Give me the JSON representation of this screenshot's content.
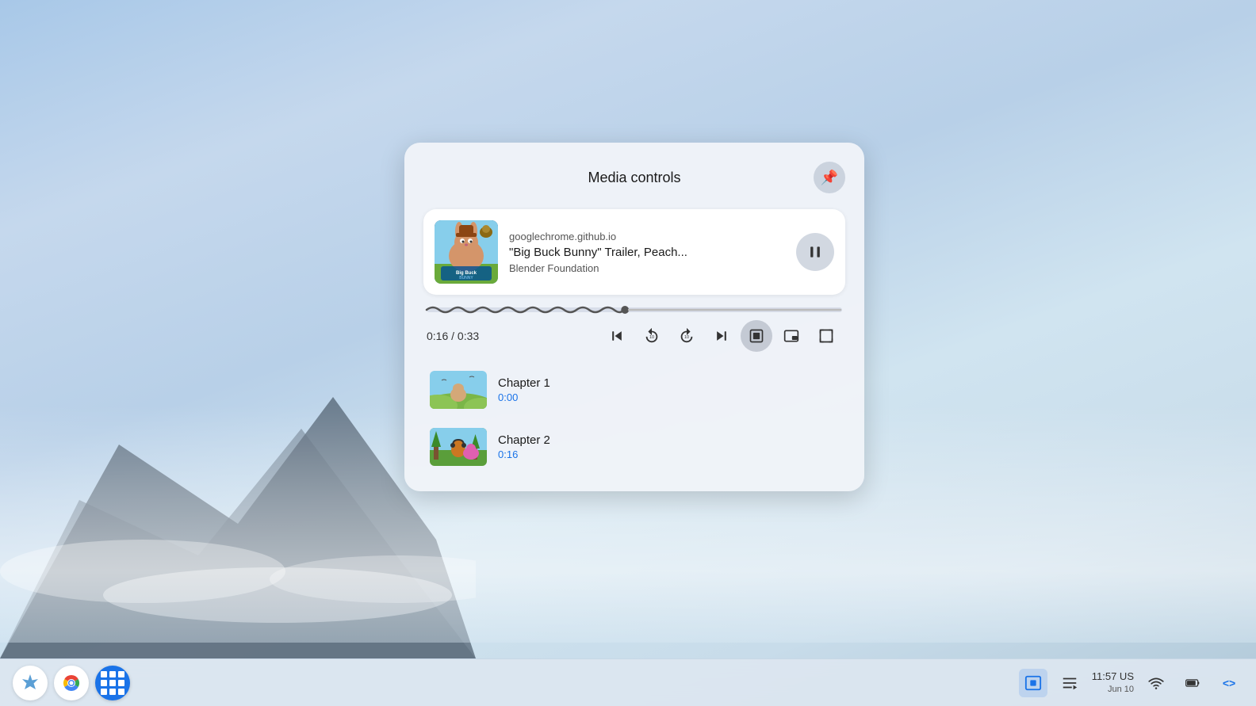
{
  "desktop": {
    "background": "sky blue gradient with mountains and clouds"
  },
  "media_panel": {
    "title": "Media controls",
    "pin_icon": "📌",
    "media_card": {
      "source": "googlechrome.github.io",
      "title": "\"Big Buck Bunny\" Trailer, Peach...",
      "artist": "Blender Foundation",
      "play_pause_icon": "⏸"
    },
    "progress": {
      "current_time": "0:16",
      "total_time": "0:33",
      "time_display": "0:16 / 0:33",
      "progress_percent": 48
    },
    "controls": {
      "skip_back_icon": "⏮",
      "rewind_icon": "↺10",
      "forward_icon": "↻10",
      "skip_next_icon": "⏭",
      "chapters_icon": "⊡",
      "pip_icon": "⧉",
      "fullscreen_icon": "⛶"
    },
    "chapters": [
      {
        "name": "Chapter 1",
        "time": "0:00"
      },
      {
        "name": "Chapter 2",
        "time": "0:16"
      }
    ]
  },
  "taskbar": {
    "left_icons": [
      {
        "name": "launcher",
        "label": "✦"
      },
      {
        "name": "chrome",
        "label": "chrome"
      },
      {
        "name": "app-launcher",
        "label": "grid"
      }
    ],
    "right": {
      "media_icon": "⊡",
      "playlist_icon": "≡♪",
      "date": "Jun 10",
      "time": "11:57 US",
      "wifi_icon": "wifi",
      "battery_icon": "battery",
      "dev_icon": "<>"
    }
  }
}
